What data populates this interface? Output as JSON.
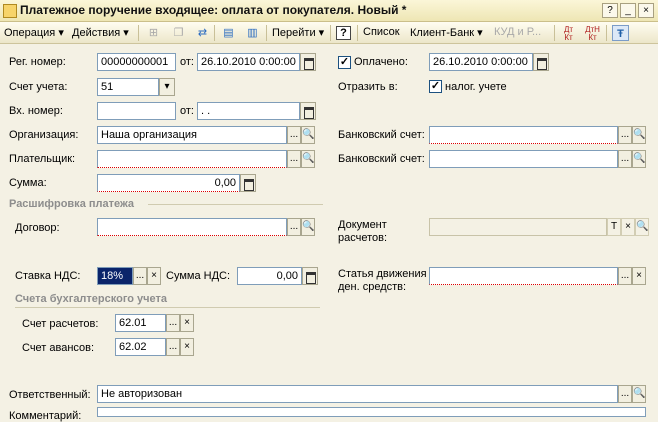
{
  "window": {
    "title": "Платежное поручение входящее: оплата от покупателя. Новый *"
  },
  "toolbar": {
    "operation": "Операция",
    "actions": "Действия",
    "goto": "Перейти",
    "help": "?",
    "list": "Список",
    "client_bank": "Клиент-Банк",
    "kud": "КУД и Р...",
    "dt_kt": "Дт Кт",
    "dt_h_kt": "ДтН Кт"
  },
  "form": {
    "reg_number_label": "Рег. номер:",
    "reg_number": "00000000001",
    "from_label": "от:",
    "reg_date": "26.10.2010  0:00:00",
    "paid_label": "Оплачено:",
    "paid_date": "26.10.2010  0:00:00",
    "account_label": "Счет учета:",
    "account": "51",
    "reflect_label": "Отразить в:",
    "tax_accounting_label": "налог. учете",
    "in_number_label": "Вх. номер:",
    "in_number": "",
    "in_from_label": "от:",
    "in_date": "  .  .",
    "organization_label": "Организация:",
    "organization": "Наша организация",
    "bank_account_label": "Банковский счет:",
    "bank_account": "",
    "payer_label": "Плательщик:",
    "payer": "",
    "payer_bank_account_label": "Банковский счет:",
    "payer_bank_account": "",
    "amount_label": "Сумма:",
    "amount": "0,00",
    "breakdown_section": "Расшифровка платежа",
    "contract_label": "Договор:",
    "contract": "",
    "settlement_doc_label": "Документ расчетов:",
    "settlement_doc": "",
    "vat_rate_label": "Ставка НДС:",
    "vat_rate": "18%",
    "vat_amount_label": "Сумма НДС:",
    "vat_amount": "0,00",
    "cash_flow_label": "Статья движения ден. средств:",
    "cash_flow": "",
    "accounts_section": "Счета бухгалтерского учета",
    "settlement_account_label": "Счет расчетов:",
    "settlement_account": "62.01",
    "advance_account_label": "Счет авансов:",
    "advance_account": "62.02",
    "responsible_label": "Ответственный:",
    "responsible": "Не авторизован",
    "comment_label": "Комментарий:"
  }
}
